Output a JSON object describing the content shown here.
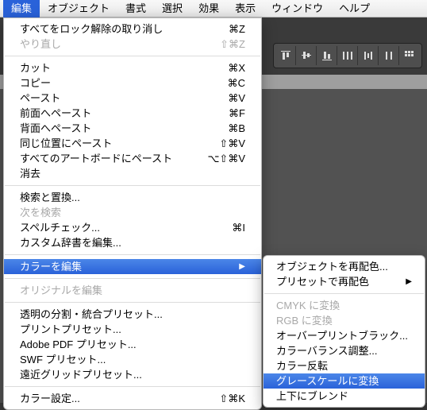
{
  "menubar": {
    "items": [
      "編集",
      "オブジェクト",
      "書式",
      "選択",
      "効果",
      "表示",
      "ウィンドウ",
      "ヘルプ"
    ],
    "selected_index": 0
  },
  "toolbar_icons": [
    "align-top",
    "align-vcenter",
    "align-bottom",
    "dist-h",
    "dist-hc",
    "dist-v",
    "grid-options"
  ],
  "edit_menu": [
    {
      "type": "item",
      "label": "すべてをロック解除の取り消し",
      "shortcut": "⌘Z"
    },
    {
      "type": "item",
      "label": "やり直し",
      "shortcut": "⇧⌘Z",
      "disabled": true
    },
    {
      "type": "sep"
    },
    {
      "type": "item",
      "label": "カット",
      "shortcut": "⌘X"
    },
    {
      "type": "item",
      "label": "コピー",
      "shortcut": "⌘C"
    },
    {
      "type": "item",
      "label": "ペースト",
      "shortcut": "⌘V"
    },
    {
      "type": "item",
      "label": "前面へペースト",
      "shortcut": "⌘F"
    },
    {
      "type": "item",
      "label": "背面へペースト",
      "shortcut": "⌘B"
    },
    {
      "type": "item",
      "label": "同じ位置にペースト",
      "shortcut": "⇧⌘V"
    },
    {
      "type": "item",
      "label": "すべてのアートボードにペースト",
      "shortcut": "⌥⇧⌘V"
    },
    {
      "type": "item",
      "label": "消去"
    },
    {
      "type": "sep"
    },
    {
      "type": "item",
      "label": "検索と置換..."
    },
    {
      "type": "item",
      "label": "次を検索",
      "disabled": true
    },
    {
      "type": "item",
      "label": "スペルチェック...",
      "shortcut": "⌘I"
    },
    {
      "type": "item",
      "label": "カスタム辞書を編集..."
    },
    {
      "type": "sep"
    },
    {
      "type": "item",
      "label": "カラーを編集",
      "submenu": true,
      "highlight": true
    },
    {
      "type": "sep"
    },
    {
      "type": "item",
      "label": "オリジナルを編集",
      "disabled": true
    },
    {
      "type": "sep"
    },
    {
      "type": "item",
      "label": "透明の分割・統合プリセット..."
    },
    {
      "type": "item",
      "label": "プリントプリセット..."
    },
    {
      "type": "item",
      "label": "Adobe PDF プリセット..."
    },
    {
      "type": "item",
      "label": "SWF プリセット..."
    },
    {
      "type": "item",
      "label": "遠近グリッドプリセット..."
    },
    {
      "type": "sep"
    },
    {
      "type": "item",
      "label": "カラー設定...",
      "shortcut": "⇧⌘K"
    }
  ],
  "color_submenu": [
    {
      "type": "item",
      "label": "オブジェクトを再配色..."
    },
    {
      "type": "item",
      "label": "プリセットで再配色",
      "submenu": true
    },
    {
      "type": "sep"
    },
    {
      "type": "item",
      "label": "CMYK に変換",
      "disabled": true
    },
    {
      "type": "item",
      "label": "RGB に変換",
      "disabled": true
    },
    {
      "type": "item",
      "label": "オーバープリントブラック..."
    },
    {
      "type": "item",
      "label": "カラーバランス調整..."
    },
    {
      "type": "item",
      "label": "カラー反転"
    },
    {
      "type": "item",
      "label": "グレースケールに変換",
      "highlight": true
    },
    {
      "type": "item",
      "label": "上下にブレンド"
    }
  ]
}
